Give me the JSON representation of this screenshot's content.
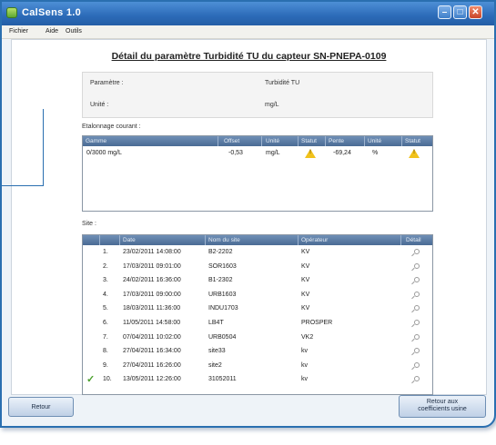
{
  "window": {
    "title": "CalSens 1.0"
  },
  "menu": [
    "Fichier",
    "Aide",
    "Outils"
  ],
  "heading": "Détail du paramètre Turbidité TU du capteur SN-PNEPA-0109",
  "param": {
    "param_label": "Paramètre :",
    "param_value": "Turbidité TU",
    "unit_label": "Unité :",
    "unit_value": "mg/L"
  },
  "etalonnage": {
    "label": "Etalonnage courant :",
    "headers": [
      "Gamme",
      "Offset",
      "Unité",
      "Statut",
      "Pente",
      "Unité",
      "Statut"
    ],
    "row": {
      "gamme": "0/3000 mg/L",
      "offset": "-0,53",
      "unite1": "mg/L",
      "statut1": "warning-icon",
      "pente": "-69,24",
      "unite2": "%",
      "statut2": "warning-icon"
    }
  },
  "site": {
    "label": "Site :",
    "headers": [
      "Date",
      "Nom du site",
      "Opérateur",
      "Détail"
    ],
    "rows": [
      {
        "num": "1.",
        "date": "23/02/2011 14:08:00",
        "nom": "B2-2202",
        "op": "KV"
      },
      {
        "num": "2.",
        "date": "17/03/2011 09:01:00",
        "nom": "SOR1603",
        "op": "KV"
      },
      {
        "num": "3.",
        "date": "24/02/2011 16:36:00",
        "nom": "B1-2302",
        "op": "KV"
      },
      {
        "num": "4.",
        "date": "17/03/2011 09:00:00",
        "nom": "URB1603",
        "op": "KV"
      },
      {
        "num": "5.",
        "date": "18/03/2011 11:36:00",
        "nom": "INDU1703",
        "op": "KV"
      },
      {
        "num": "6.",
        "date": "11/05/2011 14:58:00",
        "nom": "LB4T",
        "op": "PROSPER"
      },
      {
        "num": "7.",
        "date": "07/04/2011 10:02:00",
        "nom": "URB0504",
        "op": "VK2"
      },
      {
        "num": "8.",
        "date": "27/04/2011 16:34:00",
        "nom": "site33",
        "op": "kv"
      },
      {
        "num": "9.",
        "date": "27/04/2011 16:26:00",
        "nom": "site2",
        "op": "kv"
      },
      {
        "num": "10.",
        "date": "13/05/2011 12:26:00",
        "nom": "31052011",
        "op": "kv"
      }
    ],
    "selected_index": 9,
    "selected_mark": "✓"
  },
  "buttons": {
    "retour": "Retour",
    "retour_coef_1": "Retour aux",
    "retour_coef_2": "coefficients usine"
  },
  "colors": {
    "titlebar": "#2c6bb8",
    "grid_header": "#5a7aa3",
    "warning": "#f1c21b",
    "check": "#4aa02c"
  }
}
